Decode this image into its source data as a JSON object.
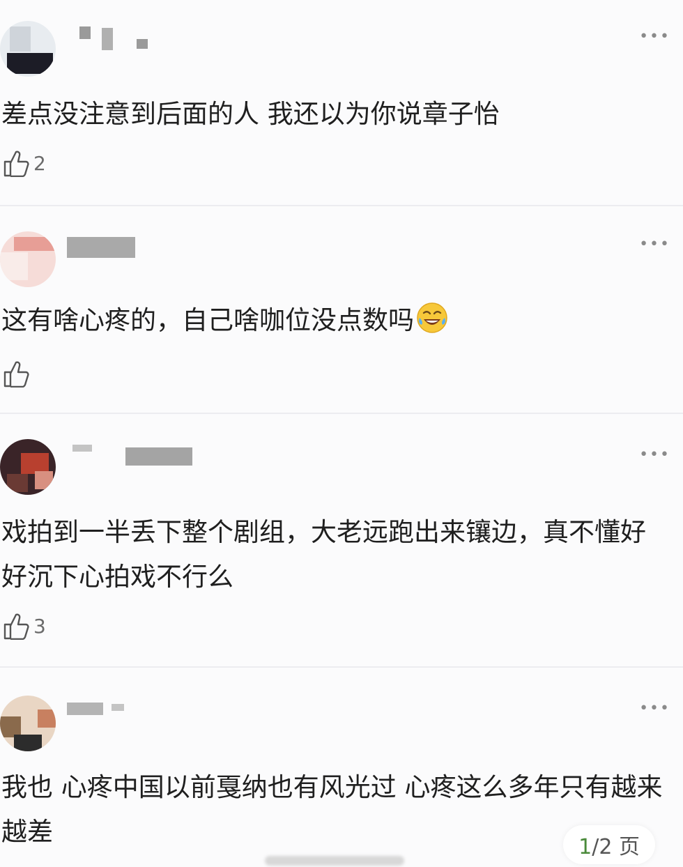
{
  "comments": [
    {
      "meta": "",
      "text": "差点没注意到后面的人 我还以为你说章子怡",
      "likes": "2",
      "avatar_colors": [
        "#e9ecef",
        "#1f1f2a",
        "#d7dbe0"
      ]
    },
    {
      "meta": "",
      "text": "这有啥心疼的，自己啥咖位没点数吗",
      "likes": "",
      "avatar_colors": [
        "#f3c9c4",
        "#f0d4d0",
        "#e8a7a0"
      ]
    },
    {
      "meta": "",
      "text": "戏拍到一半丢下整个剧组，大老远跑出来镶边，真不懂好好沉下心拍戏不行么",
      "likes": "3",
      "avatar_colors": [
        "#3a2326",
        "#c04a3a",
        "#f0e2d9"
      ]
    },
    {
      "meta": "",
      "text": "我也 心疼中国以前戛纳也有风光过 心疼这么多年只有越来越差",
      "likes": "",
      "avatar_colors": [
        "#e8d0b8",
        "#7a5a40",
        "#2a2a2a"
      ]
    }
  ],
  "more_glyph": "•••",
  "pager": {
    "current": "1",
    "rest": "/2 页"
  },
  "icons": {
    "like": "thumbs-up-icon",
    "more": "more-dots-icon",
    "emoji": "laughing-tears-emoji"
  }
}
